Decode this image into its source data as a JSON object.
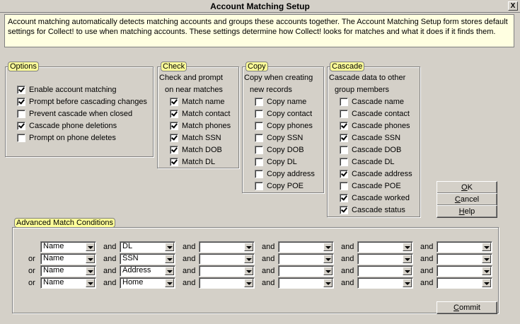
{
  "window": {
    "title": "Account Matching Setup",
    "close_glyph": "X"
  },
  "description": "Account matching automatically detects matching accounts and groups these accounts together. The Account Matching Setup form stores default settings for Collect! to use when matching accounts. These settings determine how Collect! looks for matches and what it does if it finds them.",
  "options": {
    "legend": "Options",
    "items": [
      {
        "label": "Enable account matching",
        "checked": true
      },
      {
        "label": "Prompt before cascading changes",
        "checked": true
      },
      {
        "label": "Prevent cascade when closed",
        "checked": false
      },
      {
        "label": "Cascade phone deletions",
        "checked": true
      },
      {
        "label": "Prompt on phone deletes",
        "checked": false
      }
    ]
  },
  "check": {
    "legend": "Check",
    "header1": "Check and prompt",
    "header2": "on near matches",
    "items": [
      {
        "label": "Match name",
        "checked": true
      },
      {
        "label": "Match contact",
        "checked": true
      },
      {
        "label": "Match phones",
        "checked": true
      },
      {
        "label": "Match SSN",
        "checked": true
      },
      {
        "label": "Match DOB",
        "checked": true
      },
      {
        "label": "Match DL",
        "checked": true
      }
    ]
  },
  "copy": {
    "legend": "Copy",
    "header1": "Copy when creating",
    "header2": "new records",
    "items": [
      {
        "label": "Copy name",
        "checked": false
      },
      {
        "label": "Copy contact",
        "checked": false
      },
      {
        "label": "Copy phones",
        "checked": false
      },
      {
        "label": "Copy SSN",
        "checked": false
      },
      {
        "label": "Copy DOB",
        "checked": false
      },
      {
        "label": "Copy DL",
        "checked": false
      },
      {
        "label": "Copy address",
        "checked": false
      },
      {
        "label": "Copy POE",
        "checked": false
      }
    ]
  },
  "cascade": {
    "legend": "Cascade",
    "header1": "Cascade data to other",
    "header2": "group members",
    "items": [
      {
        "label": "Cascade name",
        "checked": false
      },
      {
        "label": "Cascade contact",
        "checked": false
      },
      {
        "label": "Cascade phones",
        "checked": true
      },
      {
        "label": "Cascade SSN",
        "checked": true
      },
      {
        "label": "Cascade DOB",
        "checked": false
      },
      {
        "label": "Cascade DL",
        "checked": false
      },
      {
        "label": "Cascade address",
        "checked": true
      },
      {
        "label": "Cascade POE",
        "checked": false
      },
      {
        "label": "Cascade worked",
        "checked": true
      },
      {
        "label": "Cascade status",
        "checked": true
      }
    ]
  },
  "buttons": {
    "ok_mn": "O",
    "ok_rest": "K",
    "cancel_mn": "C",
    "cancel_rest": "ancel",
    "help_mn": "H",
    "help_rest": "elp",
    "commit_mn": "C",
    "commit_rest": "ommit"
  },
  "advanced": {
    "legend": "Advanced Match Conditions",
    "rows": [
      {
        "prefix": "",
        "values": [
          "Name",
          "DL",
          "",
          "",
          "",
          ""
        ]
      },
      {
        "prefix": "or",
        "values": [
          "Name",
          "SSN",
          "",
          "",
          "",
          ""
        ]
      },
      {
        "prefix": "or",
        "values": [
          "Name",
          "Address",
          "",
          "",
          "",
          ""
        ]
      },
      {
        "prefix": "or",
        "values": [
          "Name",
          "Home",
          "",
          "",
          "",
          ""
        ]
      }
    ],
    "and_label": "and"
  }
}
